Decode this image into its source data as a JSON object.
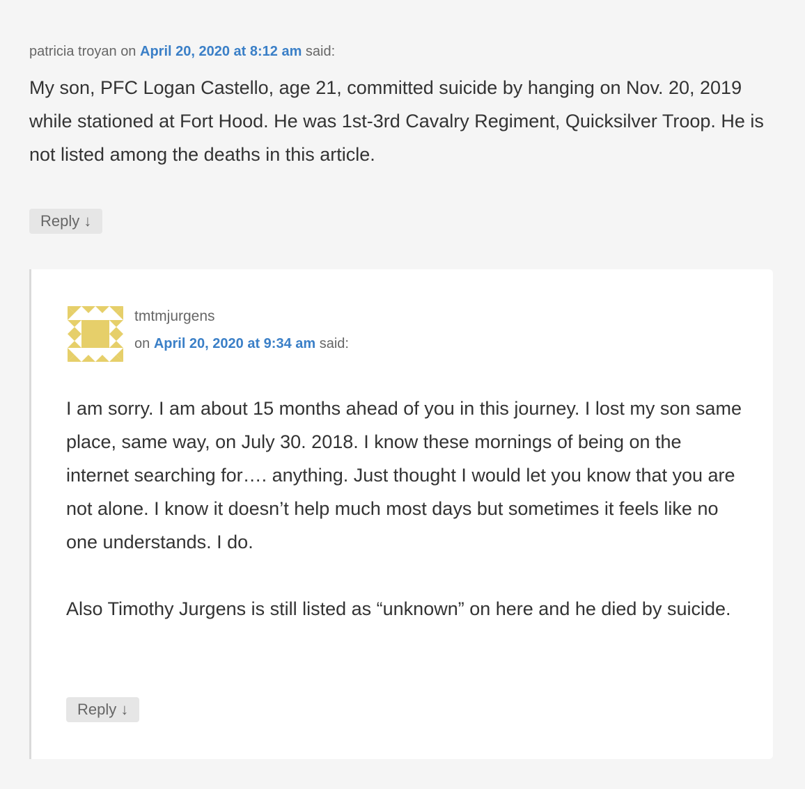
{
  "comment": {
    "author": "patricia troyan",
    "on_word": "on",
    "date_link": "April 20, 2020 at 8:12 am",
    "said": "said:",
    "text": "My son, PFC Logan Castello, age 21, committed suicide by hanging on Nov. 20, 2019 while stationed at Fort Hood. He was 1st-3rd Cavalry Regiment, Quicksilver Troop. He is not listed among the deaths in this article.",
    "reply_label": "Reply ↓"
  },
  "reply": {
    "avatar_icon": "identicon-avatar",
    "avatar_color": "#e6cf6a",
    "author": "tmtmjurgens",
    "on_word": "on",
    "date_link": "April 20, 2020 at 9:34 am",
    "said": "said:",
    "paragraphs": [
      "I am sorry. I am about 15 months ahead of you in this journey. I lost my son same place, same way, on July 30. 2018. I know these mornings of being on the internet searching for…. anything. Just thought I would let you know that you are not alone. I know it doesn’t help much most days but sometimes it feels like no one understands. I do.",
      "Also Timothy Jurgens is still listed as “unknown” on here and he died by suicide."
    ],
    "reply_label": "Reply ↓"
  },
  "colors": {
    "link": "#3a7fc7",
    "background": "#f5f5f5",
    "text": "#333333",
    "meta": "#666666"
  }
}
